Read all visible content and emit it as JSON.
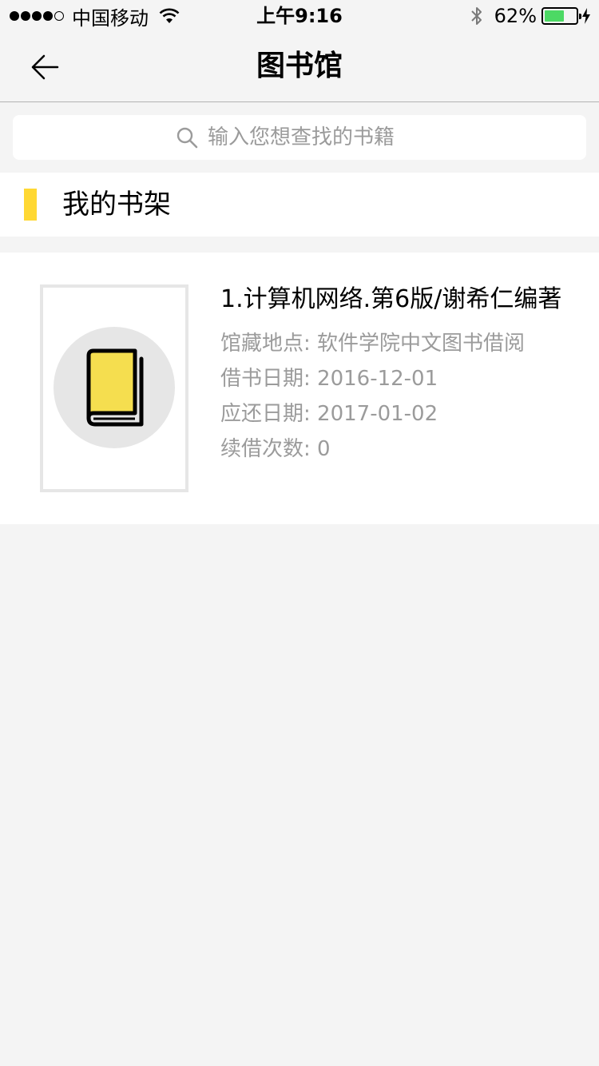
{
  "status_bar": {
    "carrier": "中国移动",
    "time": "上午9:16",
    "battery_percent": "62%",
    "battery_level": 0.62,
    "signal_bars": 4
  },
  "nav": {
    "title": "图书馆",
    "back_icon": "arrow-left-icon"
  },
  "search": {
    "placeholder": "输入您想查找的书籍",
    "icon": "search-icon"
  },
  "section": {
    "title": "我的书架",
    "accent_color": "#ffd833"
  },
  "books": [
    {
      "title": "1.计算机网络.第6版/谢希仁编著",
      "location": "馆藏地点: 软件学院中文图书借阅",
      "borrow_date": "借书日期: 2016-12-01",
      "due_date": "应还日期: 2017-01-02",
      "renew_count": "续借次数: 0",
      "cover_icon": "book-icon"
    }
  ],
  "colors": {
    "background": "#f4f4f4",
    "accent": "#ffd833",
    "meta_text": "#9b9b9b",
    "battery": "#4cd964"
  }
}
